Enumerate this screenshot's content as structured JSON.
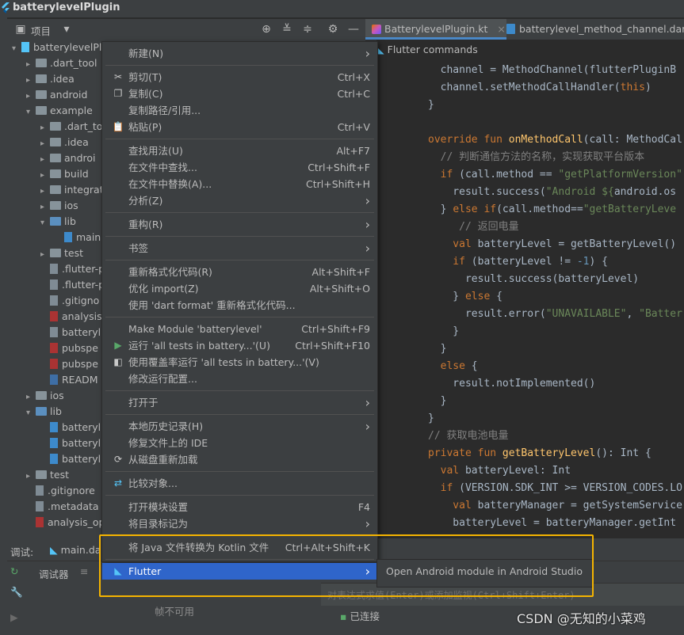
{
  "title_bar": {
    "title": "batterylevelPlugin"
  },
  "project_panel": {
    "header_label": "项目"
  },
  "tabs": [
    {
      "label": "BatterylevelPlugin.kt"
    },
    {
      "label": "batterylevel_method_channel.dart"
    }
  ],
  "tree": [
    {
      "label": "batterylevelPlu",
      "depth": 0,
      "kind": "flutter",
      "expanded": true
    },
    {
      "label": ".dart_tool",
      "depth": 1,
      "kind": "folder"
    },
    {
      "label": ".idea",
      "depth": 1,
      "kind": "folder"
    },
    {
      "label": "android",
      "depth": 1,
      "kind": "folder"
    },
    {
      "label": "example",
      "depth": 1,
      "kind": "folder",
      "expanded": true
    },
    {
      "label": ".dart_to",
      "depth": 2,
      "kind": "folder"
    },
    {
      "label": ".idea",
      "depth": 2,
      "kind": "folder"
    },
    {
      "label": "androi",
      "depth": 2,
      "kind": "folder"
    },
    {
      "label": "build",
      "depth": 2,
      "kind": "folder"
    },
    {
      "label": "integrat",
      "depth": 2,
      "kind": "folder"
    },
    {
      "label": "ios",
      "depth": 2,
      "kind": "folder"
    },
    {
      "label": "lib",
      "depth": 2,
      "kind": "folder-blue",
      "expanded": true
    },
    {
      "label": "main",
      "depth": 3,
      "kind": "dart"
    },
    {
      "label": "test",
      "depth": 2,
      "kind": "folder"
    },
    {
      "label": ".flutter-p",
      "depth": 2,
      "kind": "file"
    },
    {
      "label": ".flutter-p",
      "depth": 2,
      "kind": "file"
    },
    {
      "label": ".gitigno",
      "depth": 2,
      "kind": "file"
    },
    {
      "label": "analysis",
      "depth": 2,
      "kind": "yml"
    },
    {
      "label": "batteryl",
      "depth": 2,
      "kind": "file"
    },
    {
      "label": "pubspe",
      "depth": 2,
      "kind": "yml"
    },
    {
      "label": "pubspe",
      "depth": 2,
      "kind": "yml"
    },
    {
      "label": "READM",
      "depth": 2,
      "kind": "md"
    },
    {
      "label": "ios",
      "depth": 1,
      "kind": "folder"
    },
    {
      "label": "lib",
      "depth": 1,
      "kind": "folder-blue",
      "expanded": true
    },
    {
      "label": "batteryl",
      "depth": 2,
      "kind": "dart"
    },
    {
      "label": "batteryl",
      "depth": 2,
      "kind": "dart"
    },
    {
      "label": "batteryl",
      "depth": 2,
      "kind": "dart"
    },
    {
      "label": "test",
      "depth": 1,
      "kind": "folder"
    },
    {
      "label": ".gitignore",
      "depth": 1,
      "kind": "file"
    },
    {
      "label": ".metadata",
      "depth": 1,
      "kind": "file"
    },
    {
      "label": "analysis_op",
      "depth": 1,
      "kind": "yml"
    }
  ],
  "editor": {
    "flutter_commands": "Flutter commands",
    "lines": [
      [
        [
          "",
          "  channel = MethodChannel(flutterPluginB"
        ]
      ],
      [
        [
          "",
          "  channel.setMethodCallHandler("
        ],
        [
          "kw",
          "this"
        ],
        [
          "",
          ")"
        ]
      ],
      [
        [
          "",
          "}"
        ]
      ],
      [
        [
          "",
          ""
        ]
      ],
      [
        [
          "kw",
          "override fun "
        ],
        [
          "fn",
          "onMethodCall"
        ],
        [
          "",
          "(call: MethodCal"
        ]
      ],
      [
        [
          "cm",
          "  // 判断通信方法的名称，实现获取平台版本"
        ]
      ],
      [
        [
          "kw",
          "  if "
        ],
        [
          "",
          "(call.method == "
        ],
        [
          "str",
          "\"getPlatformVersion\""
        ]
      ],
      [
        [
          "",
          "    result.success("
        ],
        [
          "str",
          "\"Android ${"
        ],
        [
          "",
          "android.os"
        ]
      ],
      [
        [
          "",
          "  } "
        ],
        [
          "kw",
          "else if"
        ],
        [
          "",
          "(call.method=="
        ],
        [
          "str",
          "\"getBatteryLeve"
        ]
      ],
      [
        [
          "cm",
          "     // 返回电量"
        ]
      ],
      [
        [
          "kw",
          "    val "
        ],
        [
          "",
          "batteryLevel = getBatteryLevel()"
        ]
      ],
      [
        [
          "kw",
          "    if "
        ],
        [
          "",
          "(batteryLevel != "
        ],
        [
          "num",
          "-1"
        ],
        [
          "",
          ") {"
        ]
      ],
      [
        [
          "",
          "      result.success(batteryLevel)"
        ]
      ],
      [
        [
          "",
          "    } "
        ],
        [
          "kw",
          "else "
        ],
        [
          "",
          "{"
        ]
      ],
      [
        [
          "",
          "      result.error("
        ],
        [
          "str",
          "\"UNAVAILABLE\""
        ],
        [
          "",
          ", "
        ],
        [
          "str",
          "\"Batter"
        ]
      ],
      [
        [
          "",
          "    }"
        ]
      ],
      [
        [
          "",
          "  }"
        ]
      ],
      [
        [
          "kw",
          "  else "
        ],
        [
          "",
          "{"
        ]
      ],
      [
        [
          "",
          "    result.notImplemented()"
        ]
      ],
      [
        [
          "",
          "  }"
        ]
      ],
      [
        [
          "",
          "}"
        ]
      ],
      [
        [
          "cm",
          "// 获取电池电量"
        ]
      ],
      [
        [
          "kw",
          "private fun "
        ],
        [
          "fn",
          "getBatteryLevel"
        ],
        [
          "",
          "(): Int {"
        ]
      ],
      [
        [
          "kw",
          "  val "
        ],
        [
          "",
          "batteryLevel: Int"
        ]
      ],
      [
        [
          "kw",
          "  if "
        ],
        [
          "",
          "(VERSION.SDK_INT >= VERSION_CODES.LO"
        ]
      ],
      [
        [
          "kw",
          "    val "
        ],
        [
          "",
          "batteryManager = getSystemService"
        ]
      ],
      [
        [
          "",
          "    batteryLevel = batteryManager.getInt"
        ]
      ]
    ]
  },
  "context_menu": [
    {
      "label": "新建(N)",
      "shortcut": "",
      "submenu": true,
      "icon": ""
    },
    {
      "sep": true
    },
    {
      "label": "剪切(T)",
      "shortcut": "Ctrl+X",
      "icon": "scissors"
    },
    {
      "label": "复制(C)",
      "shortcut": "Ctrl+C",
      "icon": "copy"
    },
    {
      "label": "复制路径/引用...",
      "shortcut": "",
      "icon": ""
    },
    {
      "label": "粘贴(P)",
      "shortcut": "Ctrl+V",
      "icon": "paste"
    },
    {
      "sep": true
    },
    {
      "label": "查找用法(U)",
      "shortcut": "Alt+F7",
      "icon": ""
    },
    {
      "label": "在文件中查找...",
      "shortcut": "Ctrl+Shift+F",
      "icon": ""
    },
    {
      "label": "在文件中替换(A)...",
      "shortcut": "Ctrl+Shift+H",
      "icon": ""
    },
    {
      "label": "分析(Z)",
      "shortcut": "",
      "submenu": true,
      "icon": ""
    },
    {
      "sep": true
    },
    {
      "label": "重构(R)",
      "shortcut": "",
      "submenu": true,
      "icon": ""
    },
    {
      "sep": true
    },
    {
      "label": "书签",
      "shortcut": "",
      "submenu": true,
      "icon": ""
    },
    {
      "sep": true
    },
    {
      "label": "重新格式化代码(R)",
      "shortcut": "Alt+Shift+F",
      "icon": ""
    },
    {
      "label": "优化 import(Z)",
      "shortcut": "Alt+Shift+O",
      "icon": ""
    },
    {
      "label": "使用 'dart format' 重新格式化代码...",
      "shortcut": "",
      "icon": ""
    },
    {
      "sep": true
    },
    {
      "label": "Make Module 'batterylevel'",
      "shortcut": "Ctrl+Shift+F9",
      "icon": ""
    },
    {
      "label": "运行 'all tests in battery...'(U)",
      "shortcut": "Ctrl+Shift+F10",
      "icon": "run"
    },
    {
      "label": "使用覆盖率运行 'all tests in battery...'(V)",
      "shortcut": "",
      "icon": "coverage"
    },
    {
      "label": "修改运行配置...",
      "shortcut": "",
      "icon": ""
    },
    {
      "sep": true
    },
    {
      "label": "打开于",
      "shortcut": "",
      "submenu": true,
      "icon": ""
    },
    {
      "sep": true
    },
    {
      "label": "本地历史记录(H)",
      "shortcut": "",
      "submenu": true,
      "icon": ""
    },
    {
      "label": "修复文件上的 IDE",
      "shortcut": "",
      "icon": ""
    },
    {
      "label": "从磁盘重新加载",
      "shortcut": "",
      "icon": "reload"
    },
    {
      "sep": true
    },
    {
      "label": "比较对象...",
      "shortcut": "",
      "icon": "compare"
    },
    {
      "sep": true
    },
    {
      "label": "打开模块设置",
      "shortcut": "F4",
      "icon": ""
    },
    {
      "label": "将目录标记为",
      "shortcut": "",
      "submenu": true,
      "icon": ""
    },
    {
      "sep": true
    },
    {
      "label": "将 Java 文件转换为 Kotlin 文件",
      "shortcut": "Ctrl+Alt+Shift+K",
      "icon": ""
    },
    {
      "sep": true
    },
    {
      "label": "Flutter",
      "shortcut": "",
      "submenu": true,
      "icon": "flutter",
      "selected": true
    }
  ],
  "submenu": {
    "item": "Open Android module in Android Studio"
  },
  "bottom_panel": {
    "tab_label": "调试:",
    "config_label": "main.da",
    "debugger_tab": "调试器",
    "frames_unavailable": "帧不可用",
    "connected": "已连接",
    "evaluate_hint": "对表达式求值(Enter)或添加监视(Ctrl+Shift+Enter)"
  },
  "watermark": "CSDN @无知的小菜鸡",
  "colors": {
    "menu_bg": "#3c3f41",
    "selection": "#2f65ca",
    "highlight_border": "#f5b400",
    "editor_bg": "#2b2b2b"
  }
}
